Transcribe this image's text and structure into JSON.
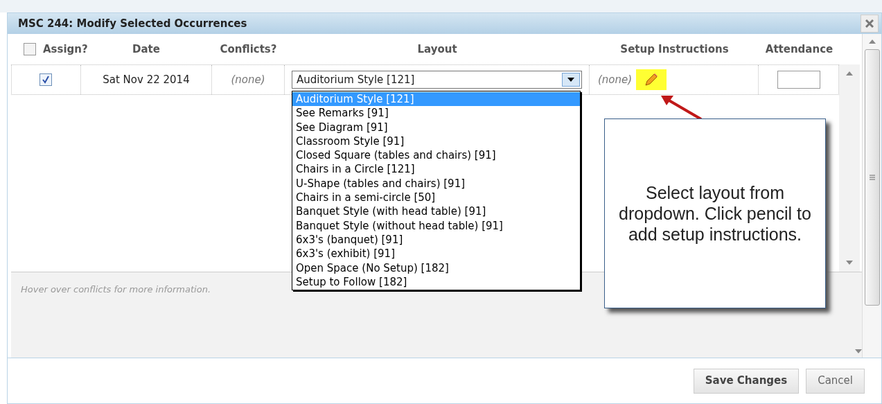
{
  "dialog": {
    "title": "MSC 244: Modify Selected Occurrences"
  },
  "table": {
    "select_all": {
      "label": "Assign?",
      "checked": false
    },
    "columns": [
      "Date",
      "Conflicts?",
      "Layout",
      "Setup Instructions",
      "Attendance"
    ],
    "rows": [
      {
        "checked": true,
        "date": "Sat Nov 22 2014",
        "conflicts": "(none)",
        "layout": "Auditorium Style [121]",
        "setup": "(none)"
      }
    ]
  },
  "layout_options": [
    {
      "label": "Auditorium Style [121]",
      "selected": true
    },
    {
      "label": "See Remarks [91]",
      "selected": false
    },
    {
      "label": "See Diagram [91]",
      "selected": false
    },
    {
      "label": "Classroom Style [91]",
      "selected": false
    },
    {
      "label": "Closed Square (tables and chairs) [91]",
      "selected": false
    },
    {
      "label": "Chairs in a Circle [121]",
      "selected": false
    },
    {
      "label": "U-Shape (tables and chairs) [91]",
      "selected": false
    },
    {
      "label": "Chairs in a semi-circle [50]",
      "selected": false
    },
    {
      "label": "Banquet Style (with head table) [91]",
      "selected": false
    },
    {
      "label": "Banquet Style (without head table) [91]",
      "selected": false
    },
    {
      "label": "6x3's (banquet) [91]",
      "selected": false
    },
    {
      "label": "6x3's (exhibit) [91]",
      "selected": false
    },
    {
      "label": "Open Space (No Setup) [182]",
      "selected": false
    },
    {
      "label": "Setup to Follow [182]",
      "selected": false
    }
  ],
  "hint": "Hover over conflicts for more information.",
  "callout": "Select layout from dropdown. Click pencil to add setup instructions.",
  "buttons": [
    "Save Changes",
    "Cancel"
  ]
}
